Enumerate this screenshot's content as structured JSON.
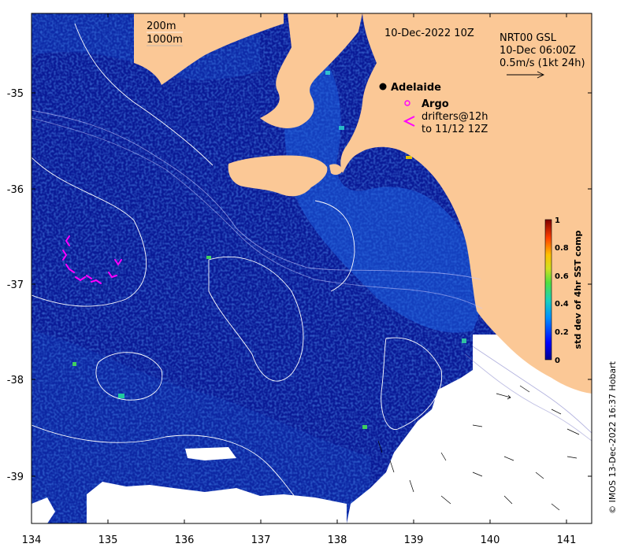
{
  "map": {
    "date_label": "10-Dec-2022 10Z",
    "current_product": {
      "line1": "NRT00 GSL",
      "line2": "10-Dec 06:00Z",
      "line3": "0.5m/s (1kt 24h)"
    },
    "depth_contours": [
      "200m",
      "1000m"
    ],
    "place": "Adelaide",
    "legend": {
      "argo": "Argo",
      "drifters_line1": "drifters@12h",
      "drifters_line2": "to 11/12 12Z"
    },
    "x_ticks": [
      "134",
      "135",
      "136",
      "137",
      "138",
      "139",
      "140",
      "141"
    ],
    "y_ticks": [
      "-35",
      "-36",
      "-37",
      "-38",
      "-39"
    ],
    "colorbar": {
      "title": "std dev of 4hr SST comp",
      "ticks": [
        "1",
        "0.8",
        "0.6",
        "0.4",
        "0.2",
        "0"
      ]
    },
    "credit": "© IMOS 13-Dec-2022 16:37 Hobart",
    "colors": {
      "land": "#fbc896",
      "ocean_base": "#0a1a96",
      "no_data": "#ffffff",
      "argo_marker": "#ff00ff",
      "drifter": "#ff00ff"
    }
  }
}
